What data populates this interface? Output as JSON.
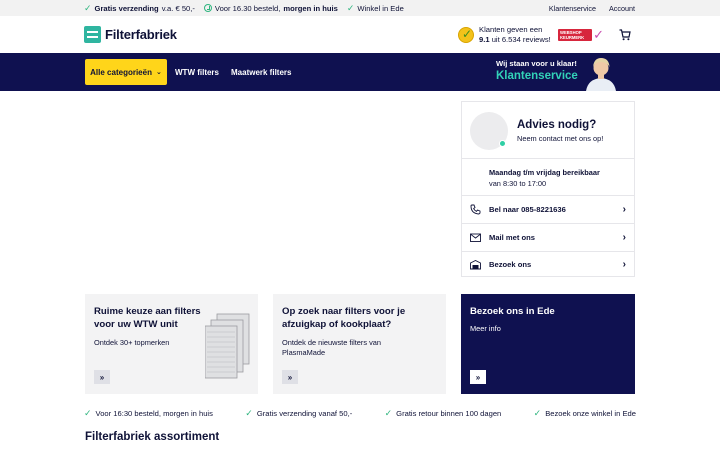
{
  "topbar": {
    "usp1_bold": "Gratis verzending",
    "usp1_rest": "v.a. € 50,-",
    "usp2_rest": "Voor 16.30 besteld,",
    "usp2_bold": "morgen in huis",
    "usp3": "Winkel in Ede",
    "link_service": "Klantenservice",
    "link_account": "Account"
  },
  "header": {
    "logo": "Filterfabriek",
    "review_line1": "Klanten geven een",
    "review_score": "9.1",
    "review_line2": "uit 6.534 reviews!",
    "badge_text": "WEBSHOP KEURMERK"
  },
  "nav": {
    "categories": "Alle categorieën",
    "link1": "WTW filters",
    "link2": "Maatwerk filters",
    "service_small": "Wij staan voor u klaar!",
    "service_big": "Klantenservice"
  },
  "advice": {
    "title": "Advies nodig?",
    "subtitle": "Neem contact met ons op!",
    "hours_bold": "Maandag t/m vrijdag bereikbaar",
    "hours": "van 8:30 to 17:00",
    "rows": [
      {
        "label": "Bel naar 085-8221636"
      },
      {
        "label": "Mail met ons"
      },
      {
        "label": "Bezoek ons"
      }
    ]
  },
  "cards": [
    {
      "title": "Ruime keuze aan filters voor uw WTW unit",
      "desc": "Ontdek 30+ topmerken"
    },
    {
      "title": "Op zoek naar filters voor je afzuigkap of kookplaat?",
      "desc": "Ontdek de nieuwste filters van PlasmaMade"
    },
    {
      "title": "Bezoek ons in Ede",
      "desc": "Meer info"
    }
  ],
  "usps": [
    "Voor 16:30 besteld, morgen in huis",
    "Gratis verzending vanaf 50,-",
    "Gratis retour binnen 100 dagen",
    "Bezoek onze winkel in Ede"
  ],
  "section_title": "Filterfabriek assortiment",
  "colors": {
    "navy": "#0f1150",
    "yellow": "#ffd51a",
    "teal": "#32d2b8",
    "green": "#2fb57f"
  }
}
